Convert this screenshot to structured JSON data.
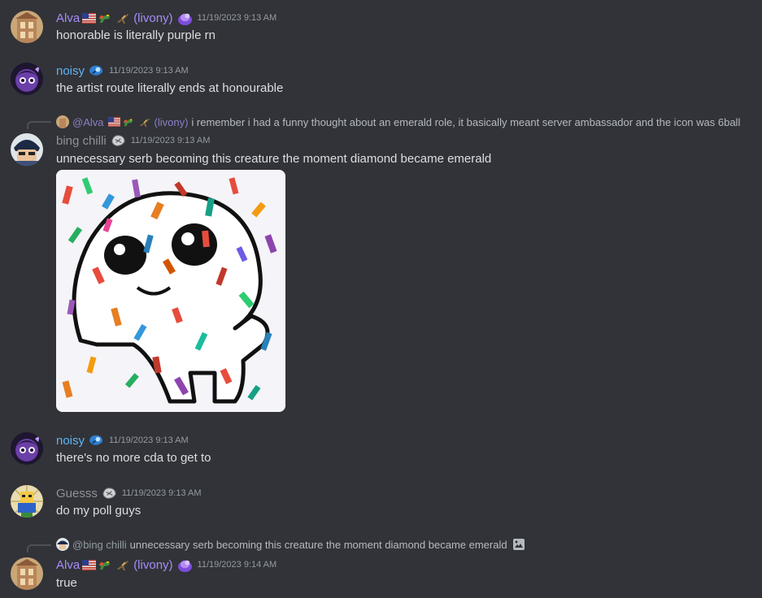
{
  "messages": [
    {
      "username": "Alva",
      "suffix": "(livony)",
      "timestamp": "11/19/2023 9:13 AM",
      "text": "honorable is literally purple rn"
    },
    {
      "username": "noisy",
      "timestamp": "11/19/2023 9:13 AM",
      "text": "the artist route literally ends at honourable"
    },
    {
      "reply_to": "@Alva",
      "reply_suffix": "(livony)",
      "reply_text": "i remember i had a funny thought about an emerald role, it basically meant server ambassador and the icon was 6ball",
      "username": "bing chilli",
      "timestamp": "11/19/2023 9:13 AM",
      "text": "unnecessary serb becoming this creature the moment diamond became emerald"
    },
    {
      "username": "noisy",
      "timestamp": "11/19/2023 9:13 AM",
      "text": "there's no more cda to get to"
    },
    {
      "username": "Guesss",
      "timestamp": "11/19/2023 9:13 AM",
      "text": "do my poll guys"
    },
    {
      "reply_to": "@bing chilli",
      "reply_text": "unnecessary serb becoming this creature the moment diamond became emerald",
      "username": "Alva",
      "suffix": "(livony)",
      "timestamp": "11/19/2023 9:14 AM",
      "text": "true"
    }
  ],
  "colors": {
    "background": "#313338",
    "purple_name": "#a78bfa",
    "blue_name": "#5fb4f5",
    "grey_name": "#8e9297"
  },
  "icons": [
    "us-flag-icon",
    "gun-icon",
    "jet-icon",
    "purple-badge-icon",
    "blue-badge-icon",
    "grey-badge-icon",
    "image-icon"
  ]
}
